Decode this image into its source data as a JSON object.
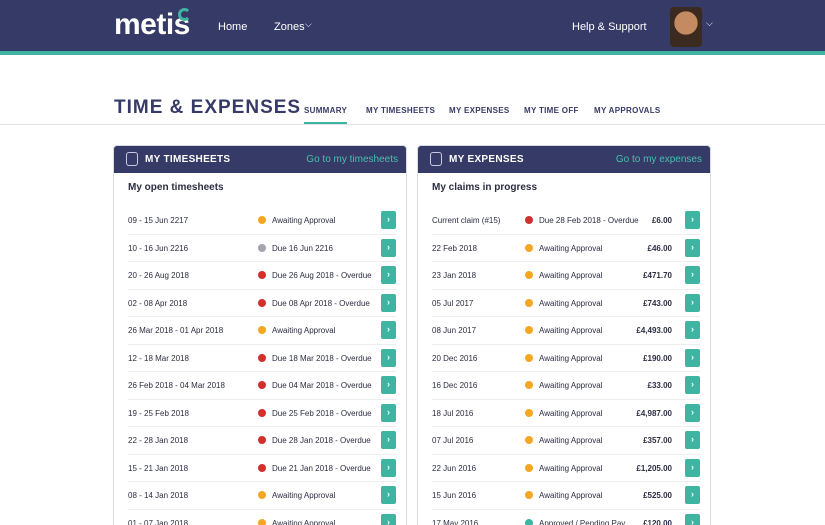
{
  "app": {
    "logo_text": "metis",
    "nav": {
      "home": "Home",
      "zones": "Zones",
      "help": "Help & Support"
    }
  },
  "page": {
    "title": "TIME & EXPENSES",
    "tabs": [
      "SUMMARY",
      "MY TIMESHEETS",
      "MY EXPENSES",
      "MY TIME OFF",
      "MY APPROVALS"
    ],
    "active_tab": "SUMMARY"
  },
  "colors": {
    "nav_bg": "#363a66",
    "accent": "#3fb5a1",
    "status_awaiting": "#f5a623",
    "status_due": "#a3a4ad",
    "status_overdue": "#d0312d",
    "status_approved": "#3fb5a1"
  },
  "timesheets": {
    "title": "MY TIMESHEETS",
    "link": "Go to my timesheets",
    "subtitle": "My open timesheets",
    "icon": "stopwatch-icon",
    "rows": [
      {
        "date": "09 - 15 Jun 2217",
        "status": "Awaiting Approval",
        "color": "#f5a623"
      },
      {
        "date": "10 - 16 Jun 2216",
        "status": "Due 16 Jun 2216",
        "color": "#a3a4ad"
      },
      {
        "date": "20 - 26 Aug 2018",
        "status": "Due 26 Aug 2018 - Overdue",
        "color": "#d0312d"
      },
      {
        "date": "02 - 08 Apr 2018",
        "status": "Due 08 Apr 2018 - Overdue",
        "color": "#d0312d"
      },
      {
        "date": "26 Mar 2018 - 01 Apr 2018",
        "status": "Awaiting Approval",
        "color": "#f5a623"
      },
      {
        "date": "12 - 18 Mar 2018",
        "status": "Due 18 Mar 2018 - Overdue",
        "color": "#d0312d"
      },
      {
        "date": "26 Feb 2018 - 04 Mar 2018",
        "status": "Due 04 Mar 2018 - Overdue",
        "color": "#d0312d"
      },
      {
        "date": "19 - 25 Feb 2018",
        "status": "Due 25 Feb 2018 - Overdue",
        "color": "#d0312d"
      },
      {
        "date": "22 - 28 Jan 2018",
        "status": "Due 28 Jan 2018 - Overdue",
        "color": "#d0312d"
      },
      {
        "date": "15 - 21 Jan 2018",
        "status": "Due 21 Jan 2018 - Overdue",
        "color": "#d0312d"
      },
      {
        "date": "08 - 14 Jan 2018",
        "status": "Awaiting Approval",
        "color": "#f5a623"
      },
      {
        "date": "01 - 07 Jan 2018",
        "status": "Awaiting Approval",
        "color": "#f5a623"
      }
    ]
  },
  "expenses": {
    "title": "MY EXPENSES",
    "link": "Go to my expenses",
    "subtitle": "My claims in progress",
    "icon": "money-bag-icon",
    "rows": [
      {
        "date": "Current claim (#15)",
        "status": "Due 28 Feb 2018 - Overdue",
        "amount": "£6.00",
        "color": "#d0312d"
      },
      {
        "date": "22 Feb 2018",
        "status": "Awaiting Approval",
        "amount": "£46.00",
        "color": "#f5a623"
      },
      {
        "date": "23 Jan 2018",
        "status": "Awaiting Approval",
        "amount": "£471.70",
        "color": "#f5a623"
      },
      {
        "date": "05 Jul 2017",
        "status": "Awaiting Approval",
        "amount": "£743.00",
        "color": "#f5a623"
      },
      {
        "date": "08 Jun 2017",
        "status": "Awaiting Approval",
        "amount": "£4,493.00",
        "color": "#f5a623"
      },
      {
        "date": "20 Dec 2016",
        "status": "Awaiting Approval",
        "amount": "£190.00",
        "color": "#f5a623"
      },
      {
        "date": "16 Dec 2016",
        "status": "Awaiting Approval",
        "amount": "£33.00",
        "color": "#f5a623"
      },
      {
        "date": "18 Jul 2016",
        "status": "Awaiting Approval",
        "amount": "£4,987.00",
        "color": "#f5a623"
      },
      {
        "date": "07 Jul 2016",
        "status": "Awaiting Approval",
        "amount": "£357.00",
        "color": "#f5a623"
      },
      {
        "date": "22 Jun 2016",
        "status": "Awaiting Approval",
        "amount": "£1,205.00",
        "color": "#f5a623"
      },
      {
        "date": "15 Jun 2016",
        "status": "Awaiting Approval",
        "amount": "£525.00",
        "color": "#f5a623"
      },
      {
        "date": "17 May 2016",
        "status": "Approved / Pending Pay",
        "amount": "£120.00",
        "color": "#3fb5a1"
      }
    ]
  }
}
